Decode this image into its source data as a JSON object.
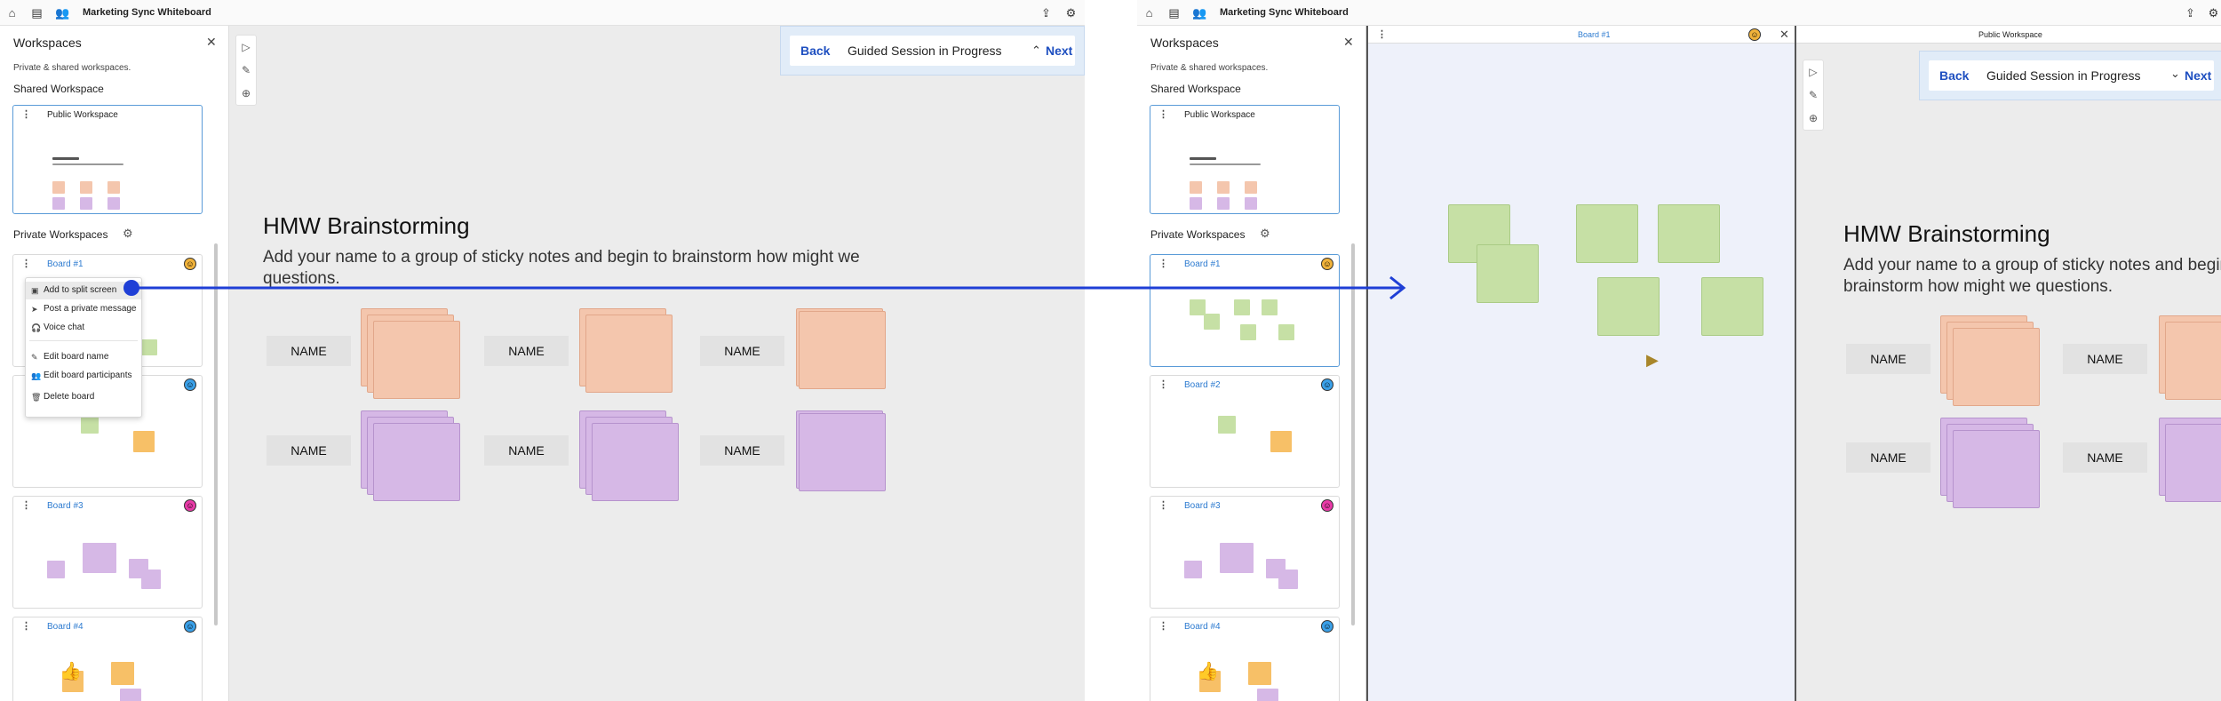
{
  "app": {
    "title": "Marketing Sync Whiteboard"
  },
  "sidebar": {
    "title": "Workspaces",
    "subtitle": "Private & shared workspaces.",
    "shared_section": "Shared Workspace",
    "shared_card": "Public Workspace",
    "private_section": "Private Workspaces",
    "boards": [
      {
        "label": "Board #1",
        "avatar_color": "#f0b23a"
      },
      {
        "label": "Board #2",
        "avatar_color": "#3aa0e8"
      },
      {
        "label": "Board #3",
        "avatar_color": "#e83aa7"
      },
      {
        "label": "Board #4",
        "avatar_color": "#3aa0e8"
      }
    ]
  },
  "context_menu": {
    "items": [
      {
        "label": "Add to split screen",
        "icon": "split-screen-icon"
      },
      {
        "label": "Post a private message",
        "icon": "send-icon"
      },
      {
        "label": "Voice chat",
        "icon": "headset-icon"
      },
      {
        "label": "Edit board name",
        "icon": "pencil-icon"
      },
      {
        "label": "Edit board participants",
        "icon": "people-icon"
      },
      {
        "label": "Delete board",
        "icon": "trash-icon"
      }
    ]
  },
  "guided": {
    "back": "Back",
    "status": "Guided Session in Progress",
    "next": "Next"
  },
  "canvas": {
    "title": "HMW Brainstorming",
    "subtitle": "Add your name to a group of sticky notes and begin to brainstorm how might we questions.",
    "name_label": "NAME"
  },
  "split_panel": {
    "board_label": "Board #1",
    "public_label": "Public Workspace"
  },
  "colors": {
    "accent": "#1e4fc0",
    "arrow": "#1f3fd6",
    "peach": "#f4c6ad",
    "lilac": "#d6b8e6",
    "green": "#c6e0a5"
  }
}
